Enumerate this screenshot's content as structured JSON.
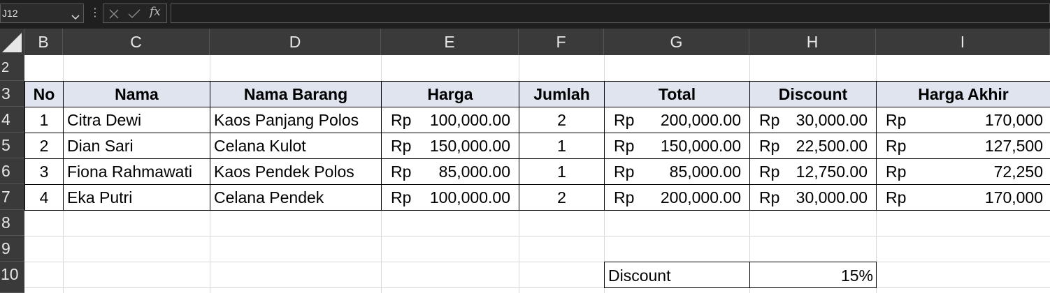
{
  "namebox": {
    "value": "J12"
  },
  "formula_bar": {
    "fx_label": "fx",
    "more": "⋮",
    "content": ""
  },
  "columns": [
    "B",
    "C",
    "D",
    "E",
    "F",
    "G",
    "H",
    "I"
  ],
  "rows": [
    "2",
    "3",
    "4",
    "5",
    "6",
    "7",
    "8",
    "9",
    "10"
  ],
  "table": {
    "headers": [
      "No",
      "Nama",
      "Nama Barang",
      "Harga",
      "Jumlah",
      "Total",
      "Discount",
      "Harga Akhir"
    ],
    "currency": "Rp",
    "records": [
      {
        "no": "1",
        "nama": "Citra Dewi",
        "barang": "Kaos Panjang Polos",
        "harga": "100,000.00",
        "jumlah": "2",
        "total": "200,000.00",
        "discount": "30,000.00",
        "akhir": "170,000"
      },
      {
        "no": "2",
        "nama": "Dian Sari",
        "barang": "Celana Kulot",
        "harga": "150,000.00",
        "jumlah": "1",
        "total": "150,000.00",
        "discount": "22,500.00",
        "akhir": "127,500"
      },
      {
        "no": "3",
        "nama": "Fiona Rahmawati",
        "barang": "Kaos Pendek Polos",
        "harga": "85,000.00",
        "jumlah": "1",
        "total": "85,000.00",
        "discount": "12,750.00",
        "akhir": "72,250"
      },
      {
        "no": "4",
        "nama": "Eka Putri",
        "barang": "Celana Pendek",
        "harga": "100,000.00",
        "jumlah": "2",
        "total": "200,000.00",
        "discount": "30,000.00",
        "akhir": "170,000"
      }
    ]
  },
  "discount_box": {
    "label": "Discount",
    "value": "15%"
  },
  "colors": {
    "header_fill": "#dfe4ee",
    "chrome": "#1f1f1f",
    "headings": "#3a3a3a"
  }
}
